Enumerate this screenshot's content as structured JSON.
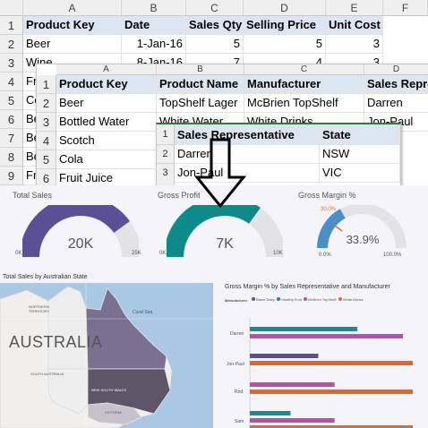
{
  "sheet1": {
    "col_headers": [
      "A",
      "B",
      "C",
      "D",
      "E",
      "F"
    ],
    "row_numbers": [
      "1",
      "2",
      "3",
      "4",
      "5",
      "6",
      "7",
      "8",
      "9"
    ],
    "headers": [
      "Product Key",
      "Date",
      "Sales Qty",
      "Selling Price",
      "Unit Cost"
    ],
    "rows": [
      [
        "Beer",
        "1-Jan-16",
        "5",
        "5",
        "3"
      ],
      [
        "Wine",
        "8-Jan-16",
        "7",
        "4",
        "3"
      ]
    ],
    "col_a_partial": [
      "Fru",
      "Col",
      "Be",
      "Be",
      "Be",
      "Fru",
      "Fru"
    ]
  },
  "sheet2": {
    "col_headers": [
      "A",
      "B",
      "C",
      "D"
    ],
    "row_numbers": [
      "1",
      "2",
      "3",
      "4",
      "5",
      "6"
    ],
    "headers": [
      "Product Key",
      "Product Name",
      "Manufacturer",
      "Sales Repre"
    ],
    "rows": [
      [
        "Beer",
        "TopShelf Lager",
        "McBrien TopShelf",
        "Darren"
      ],
      [
        "Bottled Water",
        "White Water",
        "White Drinks",
        "Jon-Paul"
      ],
      [
        "Scotch",
        "H",
        "",
        ""
      ],
      [
        "Cola",
        "C",
        "",
        ""
      ],
      [
        "Fruit Juice",
        "F",
        "",
        ""
      ]
    ]
  },
  "sheet3": {
    "col_headers": [
      "A",
      "B"
    ],
    "row_numbers": [
      "1",
      "2",
      "3"
    ],
    "headers": [
      "Sales Representative",
      "State"
    ],
    "rows": [
      [
        "Darren",
        "NSW"
      ],
      [
        "Jon-Paul",
        "VIC"
      ]
    ]
  },
  "kpis": [
    {
      "title": "Total Sales",
      "value": "20K",
      "min": "0K",
      "max": "25K",
      "fill_fraction": 0.8,
      "color": "#5b4f96"
    },
    {
      "title": "Gross Profit",
      "value": "7K",
      "min": "0K",
      "max": "10K",
      "fill_fraction": 0.7,
      "color": "#0f8a8a"
    },
    {
      "title": "Gross Margin %",
      "value": "33.9%",
      "min": "0.0%",
      "max": "100.0%",
      "target": "30.0%",
      "fill_fraction": 0.339,
      "color": "#4a8fc9"
    }
  ],
  "map": {
    "title": "Total Sales by Australian State",
    "country_label": "AUSTRALIA",
    "region_labels": [
      "NORTHERN TERRITORY",
      "SOUTH AUSTRALIA",
      "NEW SOUTH WALES",
      "VICTORIA",
      "Coral Sea",
      "QUEENSLAND"
    ]
  },
  "bar_chart": {
    "title": "Gross Margin % by Sales Representative and Manufacturer",
    "legend_label": "Manufacturer",
    "legend": [
      {
        "name": "Blane Dairy",
        "color": "#5b4f96"
      },
      {
        "name": "Healthy Fruit",
        "color": "#138f8f"
      },
      {
        "name": "McBrien TopShelf",
        "color": "#b94fa8"
      },
      {
        "name": "White Drinks",
        "color": "#e0692f"
      }
    ]
  },
  "chart_data": {
    "type": "bar",
    "title": "Gross Margin % by Sales Representative and Manufacturer",
    "categories": [
      "Darren",
      "Jon-Paul",
      "Rod",
      "Sam"
    ],
    "series": [
      {
        "name": "Blane Dairy",
        "values": [
          null,
          42,
          null,
          null
        ]
      },
      {
        "name": "Healthy Fruit",
        "values": [
          66,
          null,
          null,
          25
        ]
      },
      {
        "name": "McBrien TopShelf",
        "values": [
          94,
          null,
          52,
          52
        ]
      },
      {
        "name": "White Drinks",
        "values": [
          null,
          100,
          100,
          100
        ]
      }
    ],
    "xlim": [
      0,
      100
    ],
    "grid": false,
    "legend": "top"
  }
}
